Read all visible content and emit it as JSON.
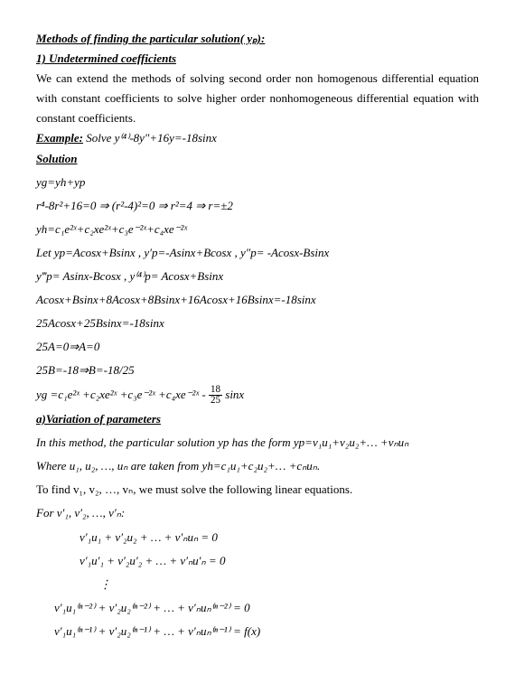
{
  "heading": "Methods of finding the particular solution( yₚ):",
  "sub1": "1) Undetermined coefficients",
  "para1": "We can extend the methods of solving second order non homogenous differential equation with constant coefficients to solve higher order nonhomogeneous differential equation with constant coefficients.",
  "example_label": "Example:",
  "example_text": "  Solve  y⁽⁴⁾-8y″+16y=-18sinx",
  "solution_label": "Solution",
  "s1": "yg=yh+yp",
  "s2": "r⁴-8r²+16=0 ⇒ (r²-4)²=0 ⇒ r²=4 ⇒ r=±2",
  "s3": "yh=c₁e²ˣ+c₂xe²ˣ+c₃e⁻²ˣ+c₄xe⁻²ˣ",
  "s4": "Let  yp=Acosx+Bsinx ,  y′p=-Asinx+Bcosx ,    y″p= -Acosx-Bsinx",
  "s5": "y‴p= Asinx-Bcosx  ,  y⁽⁴⁾p= Acosx+Bsinx",
  "s6": "Acosx+Bsinx+8Acosx+8Bsinx+16Acosx+16Bsinx=-18sinx",
  "s7": "25Acosx+25Bsinx=-18sinx",
  "s8": "25A=0⇒A=0",
  "s9": "25B=-18⇒B=-18/25",
  "s10a": "yg =c₁e²ˣ +c₂xe²ˣ +c₃e⁻²ˣ +c₄xe⁻²ˣ -",
  "s10num": "18",
  "s10den": "25",
  "s10b": "sinx",
  "sub2": "a)Variation of parameters",
  "p2a": "In this method, the particular solution yp has the form yp=v₁u₁+v₂u₂+… +vₙuₙ",
  "p2b": "Where u₁, u₂, …, uₙ are taken from yh=c₁u₁+c₂u₂+…  +cₙuₙ.",
  "p2c": "To find v₁, v₂, …, vₙ, we must solve the following linear equations.",
  "p2d": "For  v′₁, v′₂, …, v′ₙ:",
  "sys1": "v′₁u₁ + v′₂u₂ + …  + v′ₙuₙ  = 0",
  "sys2": "v′₁u′₁ + v′₂u′₂ + …   + v′ₙu′ₙ  = 0",
  "sys3": "⋮",
  "sys4": "v′₁u₁⁽ⁿ⁻²⁾ + v′₂u₂⁽ⁿ⁻²⁾ + …   + v′ₙuₙ⁽ⁿ⁻²⁾ = 0",
  "sys5": "v′₁u₁⁽ⁿ⁻¹⁾ + v′₂u₂⁽ⁿ⁻¹⁾ + …   + v′ₙuₙ⁽ⁿ⁻¹⁾ = f(x)"
}
